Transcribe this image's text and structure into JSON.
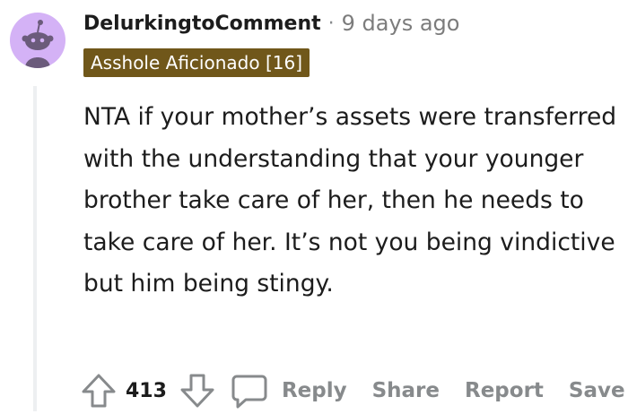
{
  "comment": {
    "author": "DelurkingtoComment",
    "separator": "·",
    "timestamp": "9 days ago",
    "flair": "Asshole Aficionado [16]",
    "body": "NTA if your mother’s assets were transferred with the understanding that your younger brother take care of her, then he needs to take care of her. It’s not you being vindictive but him being stingy.",
    "avatar_color": "#d4b2f6",
    "flair_color": "#70571a"
  },
  "actions": {
    "upvote_icon": "arrow-up-icon",
    "score": "413",
    "downvote_icon": "arrow-down-icon",
    "reply_icon": "speech-bubble-icon",
    "reply_label": "Reply",
    "share_label": "Share",
    "report_label": "Report",
    "save_label": "Save"
  }
}
